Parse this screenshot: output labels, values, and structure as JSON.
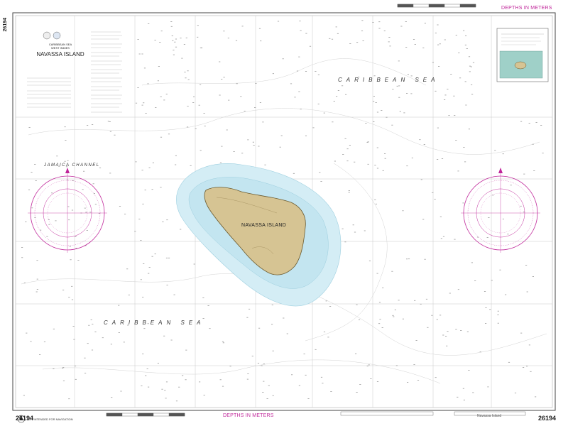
{
  "chart": {
    "number": "26194",
    "depth_unit": "DEPTHS IN METERS",
    "region_line1": "CARIBBEAN SEA",
    "region_line2": "WEST INDIES",
    "title": "NAVASSA ISLAND",
    "sea_label": "CARIBBEAN SEA",
    "channel_label": "JAMAICA CHANNEL",
    "island_label": "NAVASSA ISLAND",
    "nav_note": "NOT INTENDED FOR NAVIGATION",
    "bottom_right_label": "Navassa Island"
  },
  "colors": {
    "land": "#d6c493",
    "shallow_water": "#cfeaf3",
    "deep_water": "#ffffff",
    "compass": "#c0269a",
    "grid": "#bbbbbb"
  }
}
